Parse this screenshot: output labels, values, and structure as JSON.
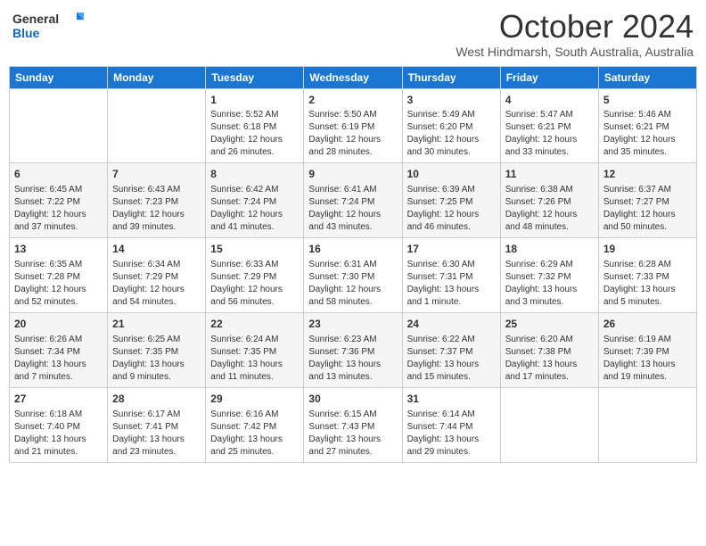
{
  "logo": {
    "line1": "General",
    "line2": "Blue"
  },
  "title": "October 2024",
  "subtitle": "West Hindmarsh, South Australia, Australia",
  "days_of_week": [
    "Sunday",
    "Monday",
    "Tuesday",
    "Wednesday",
    "Thursday",
    "Friday",
    "Saturday"
  ],
  "weeks": [
    [
      {
        "day": "",
        "content": ""
      },
      {
        "day": "",
        "content": ""
      },
      {
        "day": "1",
        "content": "Sunrise: 5:52 AM\nSunset: 6:18 PM\nDaylight: 12 hours\nand 26 minutes."
      },
      {
        "day": "2",
        "content": "Sunrise: 5:50 AM\nSunset: 6:19 PM\nDaylight: 12 hours\nand 28 minutes."
      },
      {
        "day": "3",
        "content": "Sunrise: 5:49 AM\nSunset: 6:20 PM\nDaylight: 12 hours\nand 30 minutes."
      },
      {
        "day": "4",
        "content": "Sunrise: 5:47 AM\nSunset: 6:21 PM\nDaylight: 12 hours\nand 33 minutes."
      },
      {
        "day": "5",
        "content": "Sunrise: 5:46 AM\nSunset: 6:21 PM\nDaylight: 12 hours\nand 35 minutes."
      }
    ],
    [
      {
        "day": "6",
        "content": "Sunrise: 6:45 AM\nSunset: 7:22 PM\nDaylight: 12 hours\nand 37 minutes."
      },
      {
        "day": "7",
        "content": "Sunrise: 6:43 AM\nSunset: 7:23 PM\nDaylight: 12 hours\nand 39 minutes."
      },
      {
        "day": "8",
        "content": "Sunrise: 6:42 AM\nSunset: 7:24 PM\nDaylight: 12 hours\nand 41 minutes."
      },
      {
        "day": "9",
        "content": "Sunrise: 6:41 AM\nSunset: 7:24 PM\nDaylight: 12 hours\nand 43 minutes."
      },
      {
        "day": "10",
        "content": "Sunrise: 6:39 AM\nSunset: 7:25 PM\nDaylight: 12 hours\nand 46 minutes."
      },
      {
        "day": "11",
        "content": "Sunrise: 6:38 AM\nSunset: 7:26 PM\nDaylight: 12 hours\nand 48 minutes."
      },
      {
        "day": "12",
        "content": "Sunrise: 6:37 AM\nSunset: 7:27 PM\nDaylight: 12 hours\nand 50 minutes."
      }
    ],
    [
      {
        "day": "13",
        "content": "Sunrise: 6:35 AM\nSunset: 7:28 PM\nDaylight: 12 hours\nand 52 minutes."
      },
      {
        "day": "14",
        "content": "Sunrise: 6:34 AM\nSunset: 7:29 PM\nDaylight: 12 hours\nand 54 minutes."
      },
      {
        "day": "15",
        "content": "Sunrise: 6:33 AM\nSunset: 7:29 PM\nDaylight: 12 hours\nand 56 minutes."
      },
      {
        "day": "16",
        "content": "Sunrise: 6:31 AM\nSunset: 7:30 PM\nDaylight: 12 hours\nand 58 minutes."
      },
      {
        "day": "17",
        "content": "Sunrise: 6:30 AM\nSunset: 7:31 PM\nDaylight: 13 hours\nand 1 minute."
      },
      {
        "day": "18",
        "content": "Sunrise: 6:29 AM\nSunset: 7:32 PM\nDaylight: 13 hours\nand 3 minutes."
      },
      {
        "day": "19",
        "content": "Sunrise: 6:28 AM\nSunset: 7:33 PM\nDaylight: 13 hours\nand 5 minutes."
      }
    ],
    [
      {
        "day": "20",
        "content": "Sunrise: 6:26 AM\nSunset: 7:34 PM\nDaylight: 13 hours\nand 7 minutes."
      },
      {
        "day": "21",
        "content": "Sunrise: 6:25 AM\nSunset: 7:35 PM\nDaylight: 13 hours\nand 9 minutes."
      },
      {
        "day": "22",
        "content": "Sunrise: 6:24 AM\nSunset: 7:35 PM\nDaylight: 13 hours\nand 11 minutes."
      },
      {
        "day": "23",
        "content": "Sunrise: 6:23 AM\nSunset: 7:36 PM\nDaylight: 13 hours\nand 13 minutes."
      },
      {
        "day": "24",
        "content": "Sunrise: 6:22 AM\nSunset: 7:37 PM\nDaylight: 13 hours\nand 15 minutes."
      },
      {
        "day": "25",
        "content": "Sunrise: 6:20 AM\nSunset: 7:38 PM\nDaylight: 13 hours\nand 17 minutes."
      },
      {
        "day": "26",
        "content": "Sunrise: 6:19 AM\nSunset: 7:39 PM\nDaylight: 13 hours\nand 19 minutes."
      }
    ],
    [
      {
        "day": "27",
        "content": "Sunrise: 6:18 AM\nSunset: 7:40 PM\nDaylight: 13 hours\nand 21 minutes."
      },
      {
        "day": "28",
        "content": "Sunrise: 6:17 AM\nSunset: 7:41 PM\nDaylight: 13 hours\nand 23 minutes."
      },
      {
        "day": "29",
        "content": "Sunrise: 6:16 AM\nSunset: 7:42 PM\nDaylight: 13 hours\nand 25 minutes."
      },
      {
        "day": "30",
        "content": "Sunrise: 6:15 AM\nSunset: 7:43 PM\nDaylight: 13 hours\nand 27 minutes."
      },
      {
        "day": "31",
        "content": "Sunrise: 6:14 AM\nSunset: 7:44 PM\nDaylight: 13 hours\nand 29 minutes."
      },
      {
        "day": "",
        "content": ""
      },
      {
        "day": "",
        "content": ""
      }
    ]
  ]
}
